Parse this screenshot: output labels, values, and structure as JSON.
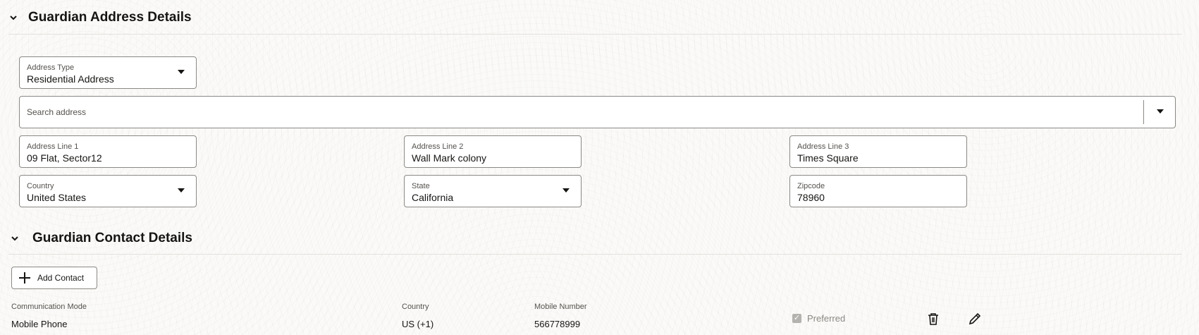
{
  "address_section": {
    "title": "Guardian Address Details",
    "address_type": {
      "label": "Address Type",
      "value": "Residential Address"
    },
    "search": {
      "placeholder": "Search address"
    },
    "line1": {
      "label": "Address Line 1",
      "value": "09 Flat, Sector12"
    },
    "line2": {
      "label": "Address Line 2",
      "value": "Wall Mark colony"
    },
    "line3": {
      "label": "Address Line 3",
      "value": "Times Square"
    },
    "country": {
      "label": "Country",
      "value": "United States"
    },
    "state": {
      "label": "State",
      "value": "California"
    },
    "zipcode": {
      "label": "Zipcode",
      "value": "78960"
    }
  },
  "contact_section": {
    "title": "Guardian Contact Details",
    "add_button_label": "Add Contact",
    "columns": {
      "communication_mode": "Communication Mode",
      "country": "Country",
      "mobile_number": "Mobile Number"
    },
    "row": {
      "communication_mode": "Mobile Phone",
      "country": "US (+1)",
      "mobile_number": "566778999",
      "preferred_label": "Preferred",
      "preferred_checked": true
    },
    "icons": {
      "delete": "trash-icon",
      "edit": "pencil-icon"
    }
  }
}
